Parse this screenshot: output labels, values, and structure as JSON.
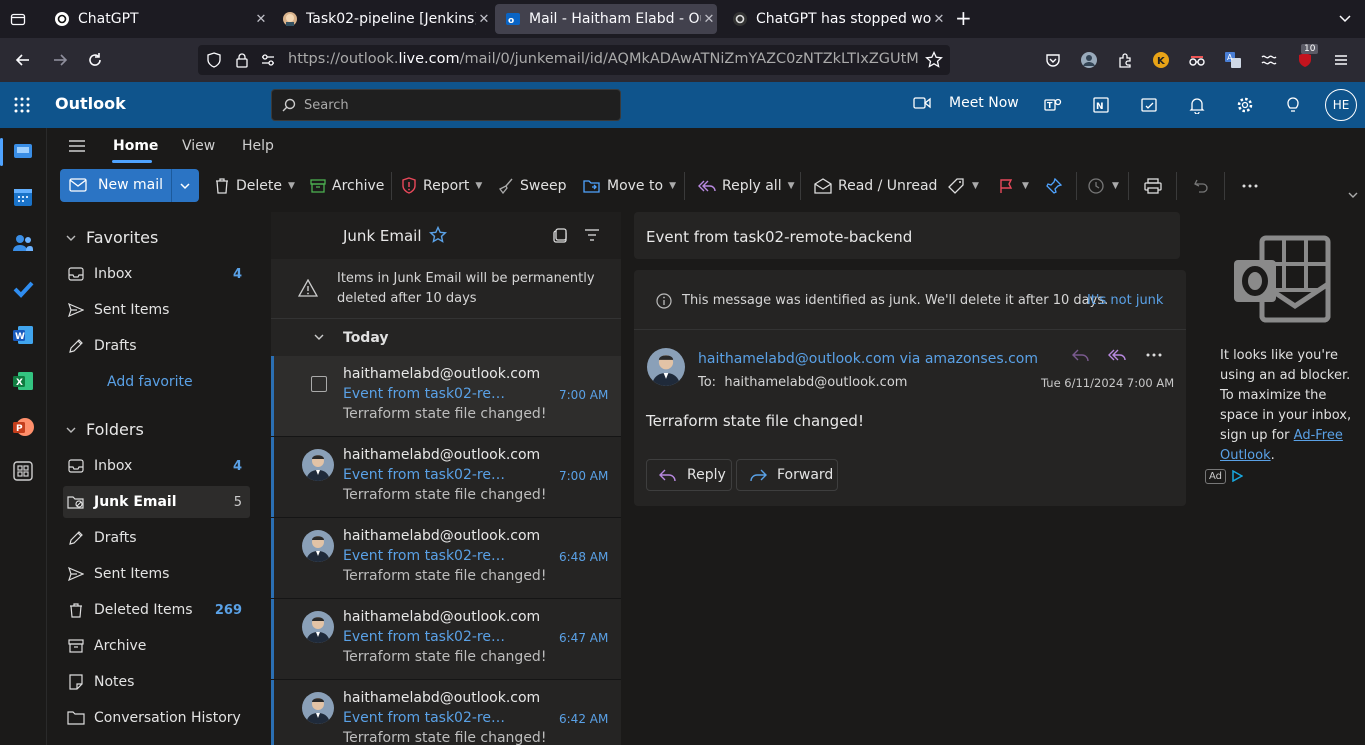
{
  "browser": {
    "tabs": [
      {
        "title": "ChatGPT",
        "active": false
      },
      {
        "title": "Task02-pipeline [Jenkins]",
        "active": false
      },
      {
        "title": "Mail - Haitham Elabd - Ou",
        "active": true
      },
      {
        "title": "ChatGPT has stopped wo",
        "active": false
      }
    ],
    "url_prefix": "https://outlook.",
    "url_domain": "live.com",
    "url_suffix": "/mail/0/junkemail/id/AQMkADAwATNiZmYAZC0zNTZkLTIxZGUtMDA",
    "notification_badge": "10"
  },
  "app": {
    "name": "Outlook",
    "search_placeholder": "Search",
    "meet_now": "Meet Now",
    "user_initials": "HE",
    "brand_color": "#0f548c"
  },
  "ribbon": {
    "tabs": [
      "Home",
      "View",
      "Help"
    ],
    "new_mail": "New mail",
    "delete": "Delete",
    "archive": "Archive",
    "report": "Report",
    "sweep": "Sweep",
    "move_to": "Move to",
    "reply_all": "Reply all",
    "read_unread": "Read / Unread"
  },
  "folders": {
    "favorites_title": "Favorites",
    "favorites": [
      {
        "label": "Inbox",
        "count": "4",
        "icon": "inbox-icon"
      },
      {
        "label": "Sent Items",
        "count": "",
        "icon": "sent-icon"
      },
      {
        "label": "Drafts",
        "count": "",
        "icon": "drafts-icon"
      }
    ],
    "add_favorite": "Add favorite",
    "folders_title": "Folders",
    "items": [
      {
        "label": "Inbox",
        "count": "4",
        "icon": "inbox-icon"
      },
      {
        "label": "Junk Email",
        "count": "5",
        "icon": "junk-icon",
        "selected": true
      },
      {
        "label": "Drafts",
        "count": "",
        "icon": "drafts-icon"
      },
      {
        "label": "Sent Items",
        "count": "",
        "icon": "sent-icon"
      },
      {
        "label": "Deleted Items",
        "count": "269",
        "icon": "trash-icon"
      },
      {
        "label": "Archive",
        "count": "",
        "icon": "archive-icon"
      },
      {
        "label": "Notes",
        "count": "",
        "icon": "notes-icon"
      },
      {
        "label": "Conversation History",
        "count": "",
        "icon": "folder-icon"
      }
    ]
  },
  "list": {
    "title": "Junk Email",
    "notice": "Items in Junk Email will be permanently deleted after 10 days",
    "group": "Today",
    "messages": [
      {
        "sender": "haithamelabd@outlook.com",
        "subject": "Event from task02-remote-backend",
        "time": "7:00 AM",
        "preview": "Terraform state file changed!"
      },
      {
        "sender": "haithamelabd@outlook.com",
        "subject": "Event from task02-remote-backend",
        "time": "7:00 AM",
        "preview": "Terraform state file changed!"
      },
      {
        "sender": "haithamelabd@outlook.com",
        "subject": "Event from task02-remote-backend",
        "time": "6:48 AM",
        "preview": "Terraform state file changed!"
      },
      {
        "sender": "haithamelabd@outlook.com",
        "subject": "Event from task02-remote-backend",
        "time": "6:47 AM",
        "preview": "Terraform state file changed!"
      },
      {
        "sender": "haithamelabd@outlook.com",
        "subject": "Event from task02-remote-backend",
        "time": "6:42 AM",
        "preview": "Terraform state file changed!"
      }
    ]
  },
  "reading": {
    "subject": "Event from task02-remote-backend",
    "junk_notice": "This message was identified as junk. We'll delete it after 10 days.",
    "not_junk": "It's not junk",
    "from": "haithamelabd@outlook.com via amazonses.com",
    "to_label": "To:",
    "to": "haithamelabd@outlook.com",
    "date": "Tue 6/11/2024 7:00 AM",
    "body": "Terraform state file changed!",
    "reply": "Reply",
    "forward": "Forward"
  },
  "ad": {
    "text": "It looks like you're using an ad blocker. To maximize the space in your inbox, sign up for",
    "link": "Ad-Free Outlook",
    "period": ".",
    "badge": "Ad"
  }
}
